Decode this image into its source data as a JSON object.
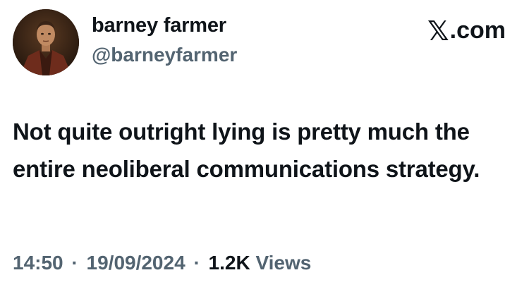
{
  "author": {
    "display_name": "barney farmer",
    "handle": "@barneyfarmer",
    "avatar": "portrait-painting-avatar"
  },
  "brand": {
    "mark": "𝕏",
    "text": ".com"
  },
  "tweet": {
    "text": "Not quite outright lying is pretty much the entire neoliberal communications strategy."
  },
  "meta": {
    "time": "14:50",
    "date": "19/09/2024",
    "separator": "·",
    "views_count": "1.2K",
    "views_label": "Views"
  },
  "colors": {
    "text_primary": "#0f1419",
    "text_secondary": "#536471",
    "background": "#ffffff"
  }
}
